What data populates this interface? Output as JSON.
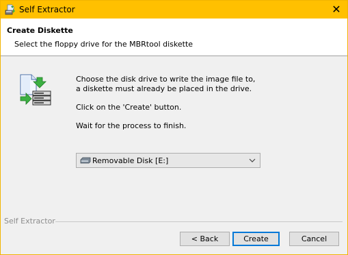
{
  "window": {
    "title": "Self Extractor",
    "close_glyph": "✕",
    "app_icon": "self-extractor-icon"
  },
  "header": {
    "title": "Create Diskette",
    "subtitle": "Select the floppy drive for the MBRtool diskette"
  },
  "content": {
    "icon": "floppy-write-icon",
    "line1": "Choose the disk drive to write the image file to,",
    "line2": "a diskette must already be placed in the drive.",
    "line3": "Click on the 'Create' button.",
    "line4": "Wait for the process to finish."
  },
  "drive_select": {
    "value": "Removable Disk [E:]",
    "icon": "removable-disk-icon"
  },
  "footer": {
    "group_label": "Self Extractor",
    "back_label": "< Back",
    "create_label": "Create",
    "cancel_label": "Cancel"
  },
  "colors": {
    "titlebar": "#ffc000",
    "focus_border": "#0078d7"
  }
}
